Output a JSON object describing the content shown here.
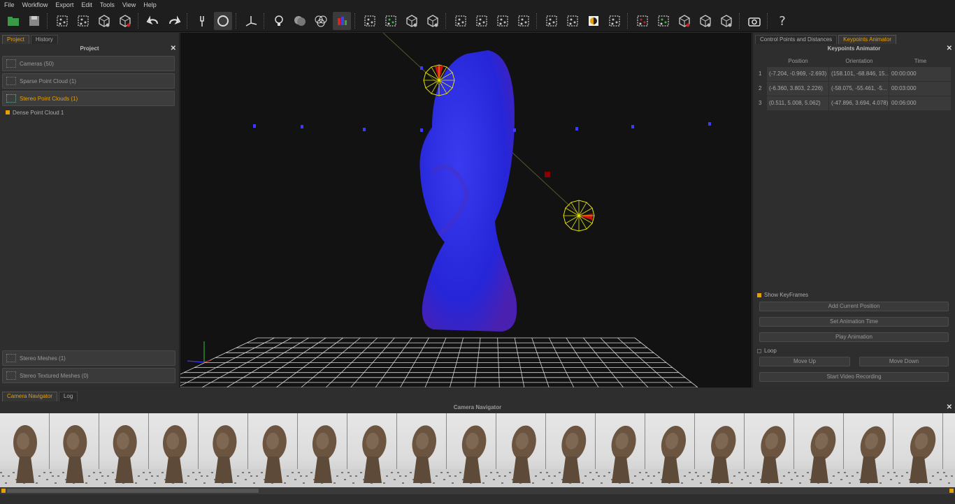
{
  "menu": [
    "File",
    "Workflow",
    "Export",
    "Edit",
    "Tools",
    "View",
    "Help"
  ],
  "toolbar": {
    "buttons": [
      "open-project-icon",
      "save-icon",
      "sep",
      "sparse-cloud-icon",
      "dense-cloud-icon",
      "mesh-icon",
      "textured-mesh-icon",
      "sep",
      "undo-icon",
      "redo-icon",
      "sep",
      "tool-icon",
      "orbit-icon",
      "sep",
      "axes-icon",
      "sep",
      "light-icon",
      "color-mode-icon",
      "rgb-icon",
      "chart-icon",
      "sep",
      "points-icon",
      "points-green-icon",
      "cube-icon",
      "cube-wire-icon",
      "sep",
      "select-cam-icon",
      "square-icon",
      "square-2-icon",
      "square-3-icon",
      "sep",
      "select-region-icon",
      "move-region-icon",
      "contrast-icon",
      "crop-icon",
      "sep",
      "filter-red-icon",
      "filter-green-icon",
      "box-red-icon",
      "box-grid-icon",
      "box-check-icon",
      "sep",
      "camera-icon",
      "sep",
      "help-icon"
    ]
  },
  "left_panel": {
    "tabs": [
      "Project",
      "History"
    ],
    "title": "Project",
    "items": [
      {
        "label": "Cameras (50)",
        "selected": false
      },
      {
        "label": "Sparse Point Cloud (1)",
        "selected": false
      },
      {
        "label": "Stereo Point Clouds (1)",
        "selected": true
      }
    ],
    "leaf": "Dense Point Cloud 1",
    "bottom_items": [
      {
        "label": "Stereo Meshes (1)"
      },
      {
        "label": "Stereo Textured Meshes (0)"
      }
    ]
  },
  "right_panel": {
    "tabs": [
      "Control Points and Distances",
      "Keypoints Animator"
    ],
    "title": "Keypoints Animator",
    "columns": [
      "Position",
      "Orientation",
      "Time"
    ],
    "rows": [
      {
        "idx": "1",
        "position": "(-7.204, -0.969, -2.693)",
        "orientation": "(158.101, -68.846, 15...",
        "time": "00:00:000"
      },
      {
        "idx": "2",
        "position": "(-6.360, 3.803, 2.226)",
        "orientation": "(-58.075, -55.461, -5...",
        "time": "00:03:000"
      },
      {
        "idx": "3",
        "position": "(0.511, 5.008, 5.062)",
        "orientation": "(-47.896, 3.694, 4.078)",
        "time": "00:06:000"
      }
    ],
    "show_keyframes": "Show KeyFrames",
    "add_position": "Add Current Position",
    "set_time": "Set Animation Time",
    "play": "Play Animation",
    "loop": "Loop",
    "move_up": "Move Up",
    "move_down": "Move Down",
    "record": "Start Video Recording"
  },
  "bottom": {
    "tabs": [
      "Camera Navigator",
      "Log"
    ],
    "title": "Camera Navigator",
    "thumb_count": 20
  },
  "colors": {
    "accent": "#e8a000",
    "cloud": "#2b2bd8",
    "camera": "#e6e600"
  }
}
